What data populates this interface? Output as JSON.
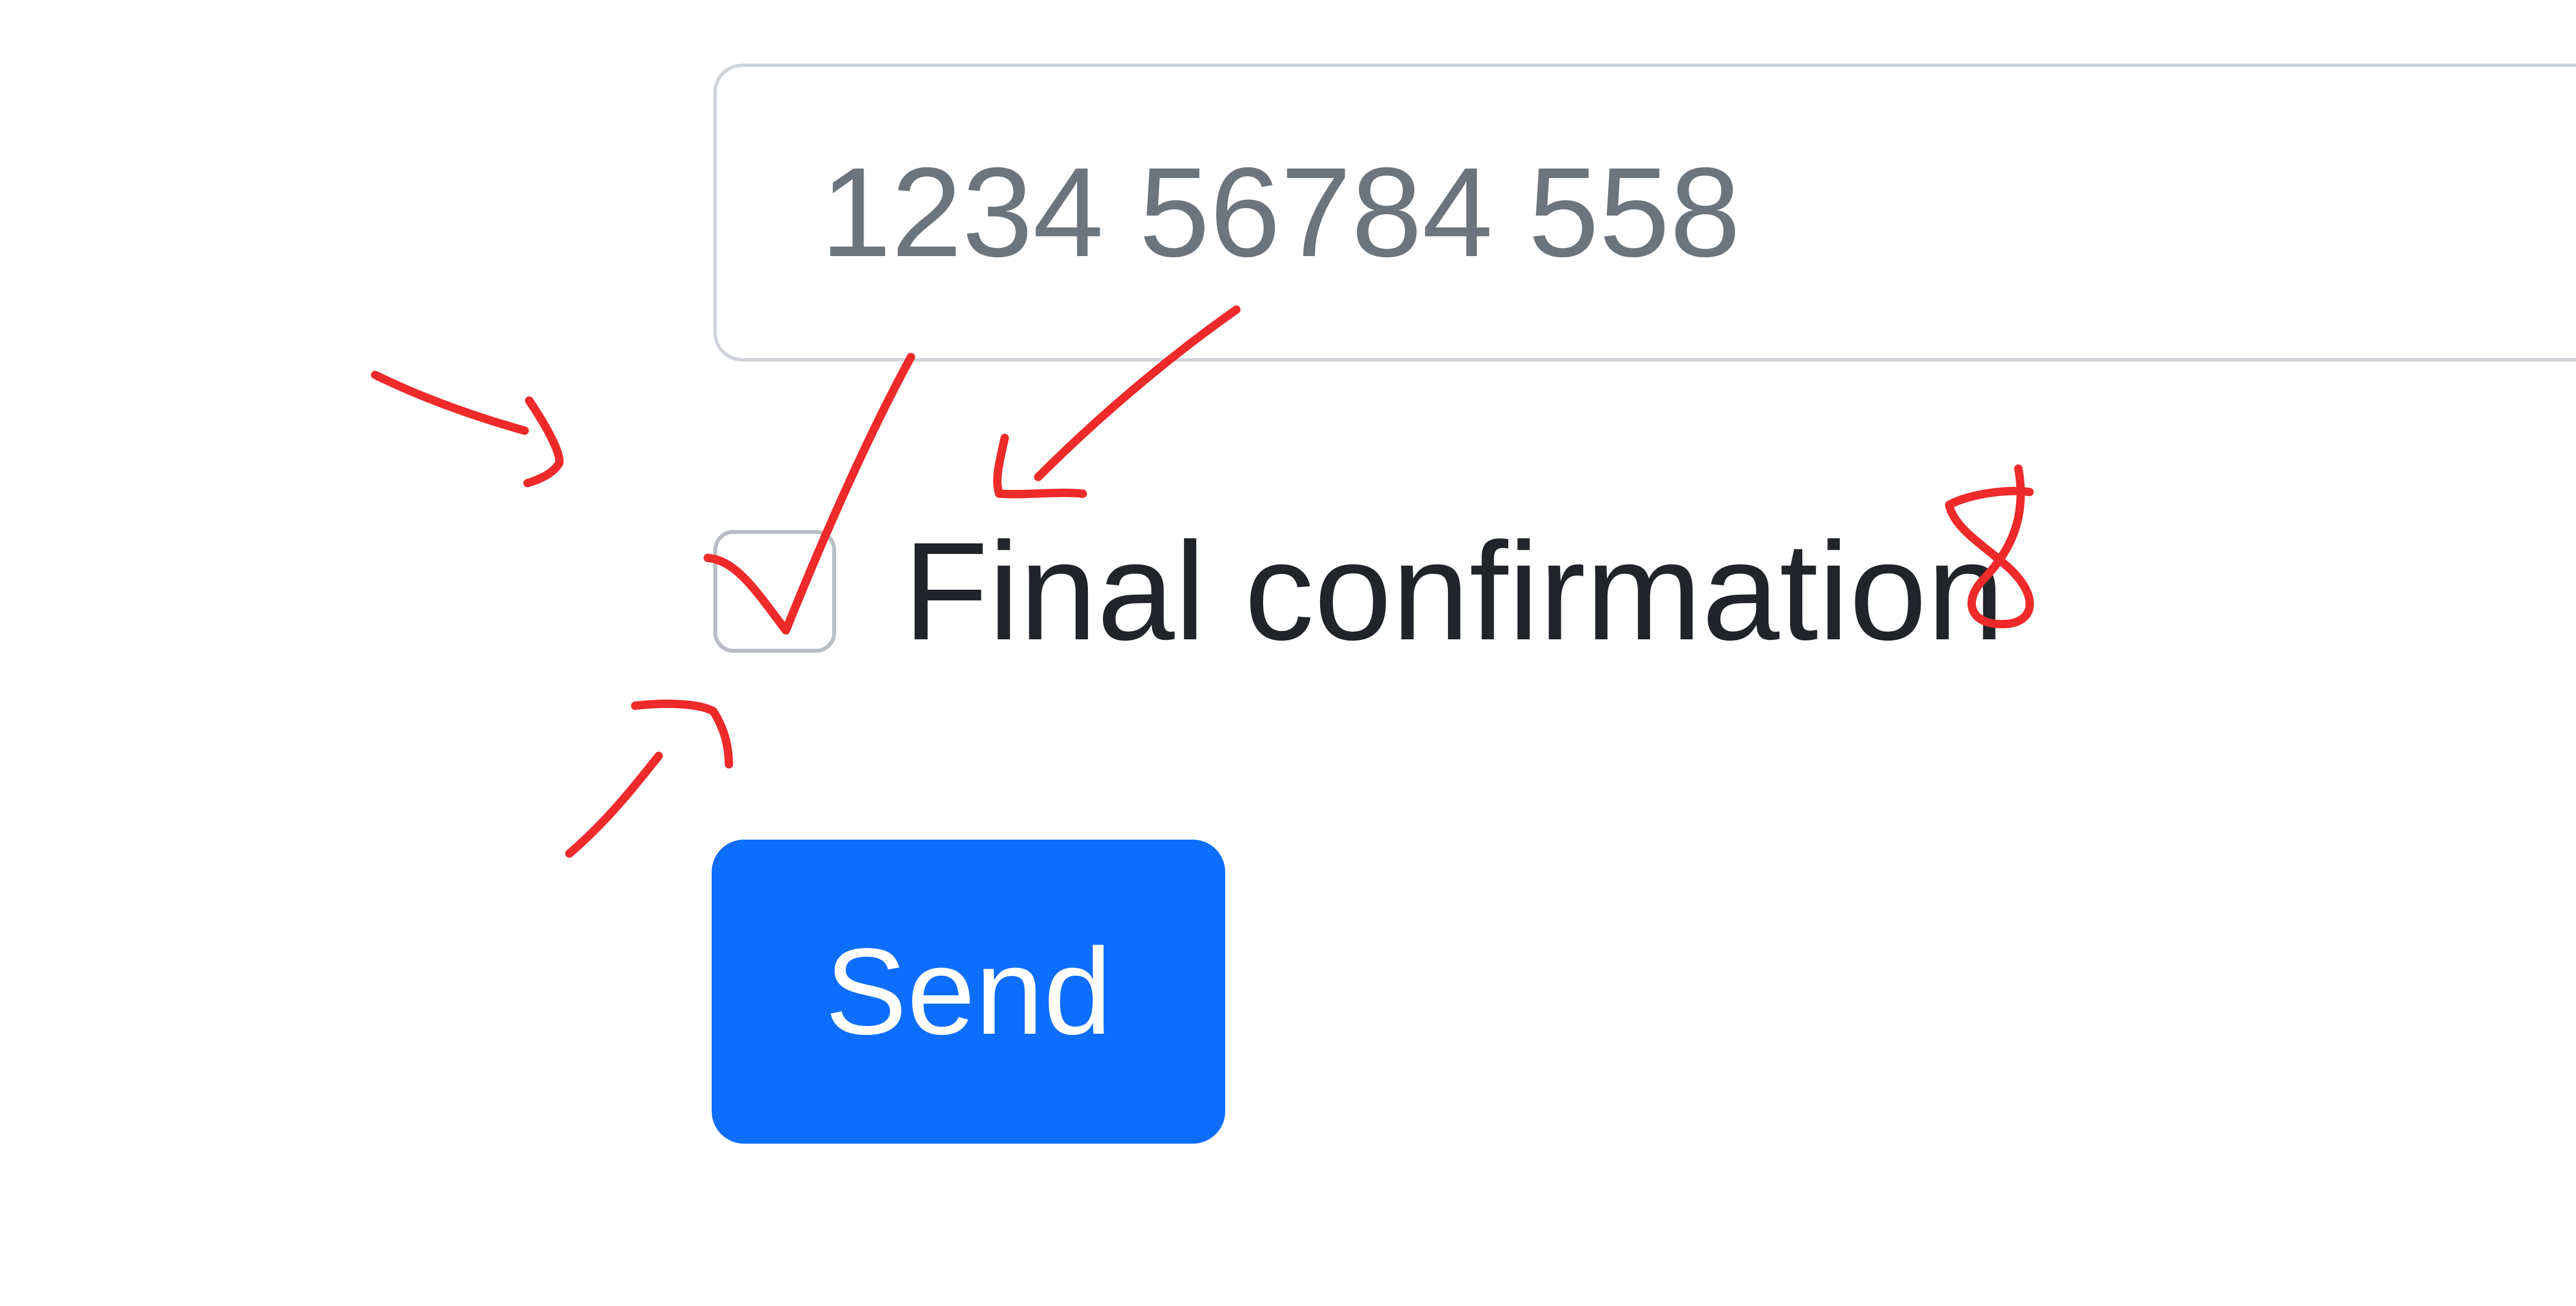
{
  "form": {
    "phone_input": {
      "value": "",
      "placeholder": "1234 56784 558"
    },
    "final_confirmation": {
      "checked": false,
      "label": "Final confirmation"
    },
    "send_button_label": "Send"
  },
  "annotations": {
    "color": "#ee2a2a",
    "handwritten_number": "8",
    "marks": [
      "arrow",
      "arrow",
      "arrow",
      "check-mark"
    ]
  }
}
